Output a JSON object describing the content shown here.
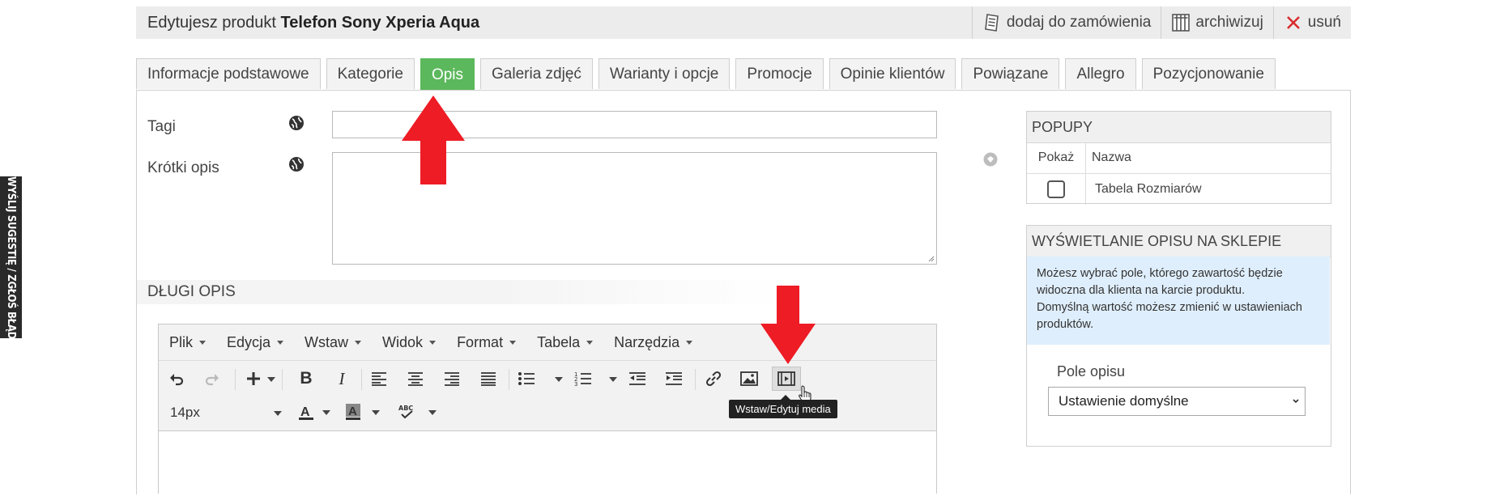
{
  "feedback": "WYŚLIJ SUGESTIĘ / ZGŁOŚ BŁĄD",
  "header": {
    "title_prefix": "Edytujesz produkt",
    "product_name": "Telefon Sony Xperia Aqua",
    "actions": {
      "add_to_order": "dodaj do zamówienia",
      "archive": "archiwizuj",
      "delete": "usuń"
    }
  },
  "tabs": [
    {
      "label": "Informacje podstawowe"
    },
    {
      "label": "Kategorie"
    },
    {
      "label": "Opis"
    },
    {
      "label": "Galeria zdjęć"
    },
    {
      "label": "Warianty i opcje"
    },
    {
      "label": "Promocje"
    },
    {
      "label": "Opinie klientów"
    },
    {
      "label": "Powiązane"
    },
    {
      "label": "Allegro"
    },
    {
      "label": "Pozycjonowanie"
    }
  ],
  "active_tab": "Opis",
  "form": {
    "tags_label": "Tagi",
    "tags_value": "",
    "short_desc_label": "Krótki opis",
    "short_desc_value": "",
    "long_desc_heading": "DŁUGI OPIS"
  },
  "editor": {
    "menus": [
      "Plik",
      "Edycja",
      "Wstaw",
      "Widok",
      "Format",
      "Tabela",
      "Narzędzia"
    ],
    "font_size": "14px",
    "tooltip": "Wstaw/Edytuj media"
  },
  "popups": {
    "title": "POPUPY",
    "col_show": "Pokaż",
    "col_name": "Nazwa",
    "rows": [
      {
        "name": "Tabela Rozmiarów",
        "checked": false
      }
    ]
  },
  "display": {
    "title": "WYŚWIETLANIE OPISU NA SKLEPIE",
    "info_line1": "Możesz wybrać pole, którego zawartość będzie widoczna dla klienta na karcie produktu.",
    "info_line2": "Domyślną wartość możesz zmienić w ustawieniach produktów.",
    "field_label": "Pole opisu",
    "field_value": "Ustawienie domyślne"
  },
  "colors": {
    "active_tab": "#5cb85c",
    "annotation_arrow": "#ee1c25",
    "info_bg": "#dfeefc"
  }
}
